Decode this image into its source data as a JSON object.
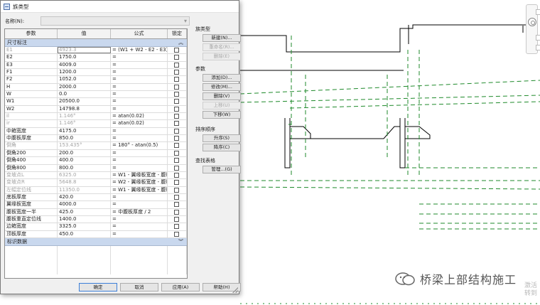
{
  "dialog": {
    "title": "族类型",
    "name_label": "名称(N):",
    "name_value": ""
  },
  "table": {
    "headers": [
      "参数",
      "值",
      "公式",
      "锁定"
    ],
    "group_dimensions": "尺寸标注",
    "group_identity": "标识数据",
    "rows": [
      {
        "param": "E1",
        "value": "4923.3",
        "formula": "= (W1 + W2 - E2 - E3) /",
        "gray": true,
        "sel": true
      },
      {
        "param": "E2",
        "value": "1750.0",
        "formula": "=",
        "gray": false
      },
      {
        "param": "E3",
        "value": "4009.0",
        "formula": "=",
        "gray": false
      },
      {
        "param": "F1",
        "value": "1200.0",
        "formula": "=",
        "gray": false
      },
      {
        "param": "F2",
        "value": "1052.0",
        "formula": "=",
        "gray": false
      },
      {
        "param": "H",
        "value": "2000.0",
        "formula": "=",
        "gray": false
      },
      {
        "param": "W",
        "value": "0.0",
        "formula": "=",
        "gray": false
      },
      {
        "param": "W1",
        "value": "20500.0",
        "formula": "=",
        "gray": false
      },
      {
        "param": "W2",
        "value": "14798.8",
        "formula": "=",
        "gray": false
      },
      {
        "param": "il",
        "value": "1.146°",
        "formula": "= atan(0.02)",
        "gray": true
      },
      {
        "param": "ir",
        "value": "1.146°",
        "formula": "= atan(0.02)",
        "gray": true
      },
      {
        "param": "中箱宽度",
        "value": "4175.0",
        "formula": "=",
        "gray": false
      },
      {
        "param": "中腹板厚度",
        "value": "850.0",
        "formula": "=",
        "gray": false
      },
      {
        "param": "倒角",
        "value": "153.435°",
        "formula": "= 180° - atan(0.5)",
        "gray": true
      },
      {
        "param": "倒角200",
        "value": "200.0",
        "formula": "=",
        "gray": false
      },
      {
        "param": "倒角400",
        "value": "400.0",
        "formula": "=",
        "gray": false
      },
      {
        "param": "倒角800",
        "value": "800.0",
        "formula": "=",
        "gray": false
      },
      {
        "param": "变坡点L",
        "value": "6325.0",
        "formula": "= W1 - 翼缘板宽度 - 腹板",
        "gray": true
      },
      {
        "param": "变坡点R",
        "value": "5648.8",
        "formula": "= W2 - 翼缘板宽度 - 腹板",
        "gray": true
      },
      {
        "param": "左幅定位线",
        "value": "11350.0",
        "formula": "= W1 - 翼缘板宽度 - 腹板",
        "gray": true
      },
      {
        "param": "底板厚度",
        "value": "420.0",
        "formula": "=",
        "gray": false
      },
      {
        "param": "翼缘板宽度",
        "value": "4000.0",
        "formula": "=",
        "gray": false
      },
      {
        "param": "腹板宽度一半",
        "value": "425.0",
        "formula": "= 中腹板厚度 / 2",
        "gray": false
      },
      {
        "param": "腹板重直定位线",
        "value": "1400.0",
        "formula": "=",
        "gray": false
      },
      {
        "param": "边箱宽度",
        "value": "3325.0",
        "formula": "=",
        "gray": false
      },
      {
        "param": "顶板厚度",
        "value": "450.0",
        "formula": "=",
        "gray": false
      }
    ]
  },
  "sidebar": {
    "family_types_label": "族类型",
    "new_label": "新建(N)...",
    "rename_label": "重命名(R)...",
    "delete_type_label": "删除(E)",
    "params_label": "参数",
    "add_label": "添加(D)...",
    "modify_label": "修改(M)...",
    "remove_label": "删除(V)",
    "move_up_label": "上移(U)",
    "move_down_label": "下移(W)",
    "sort_label": "排序顺序",
    "ascending_label": "升序(S)",
    "descending_label": "降序(C)",
    "lookup_label": "查找表格",
    "manage_label": "管理...(G)"
  },
  "footer": {
    "ok_label": "确定",
    "cancel_label": "取消",
    "apply_label": "应用(A)",
    "help_label": "帮助(H)"
  },
  "watermark": {
    "text": "桥梁上部结构施工",
    "activate_line1": "激活",
    "activate_line2": "转到"
  }
}
